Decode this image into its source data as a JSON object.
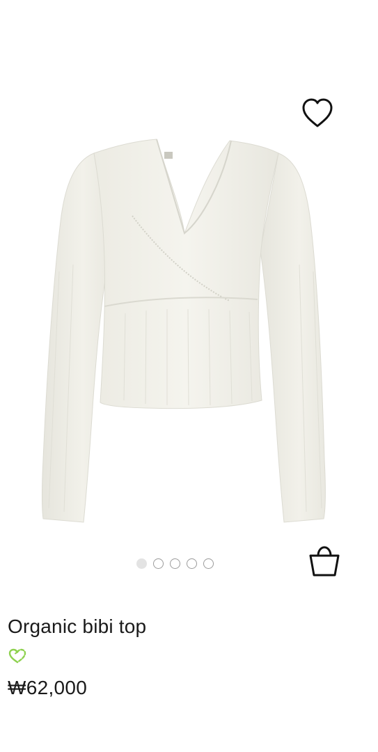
{
  "product": {
    "name": "Organic bibi top",
    "price": "₩62,000",
    "image_alt": "Organic bibi top",
    "eco_icon": "recycle-heart-icon",
    "eco_color": "#8ed14f"
  },
  "gallery": {
    "total_images": 5,
    "current_index": 1
  },
  "actions": {
    "wishlist_icon": "heart-outline-icon",
    "cart_icon": "shopping-bag-icon"
  }
}
